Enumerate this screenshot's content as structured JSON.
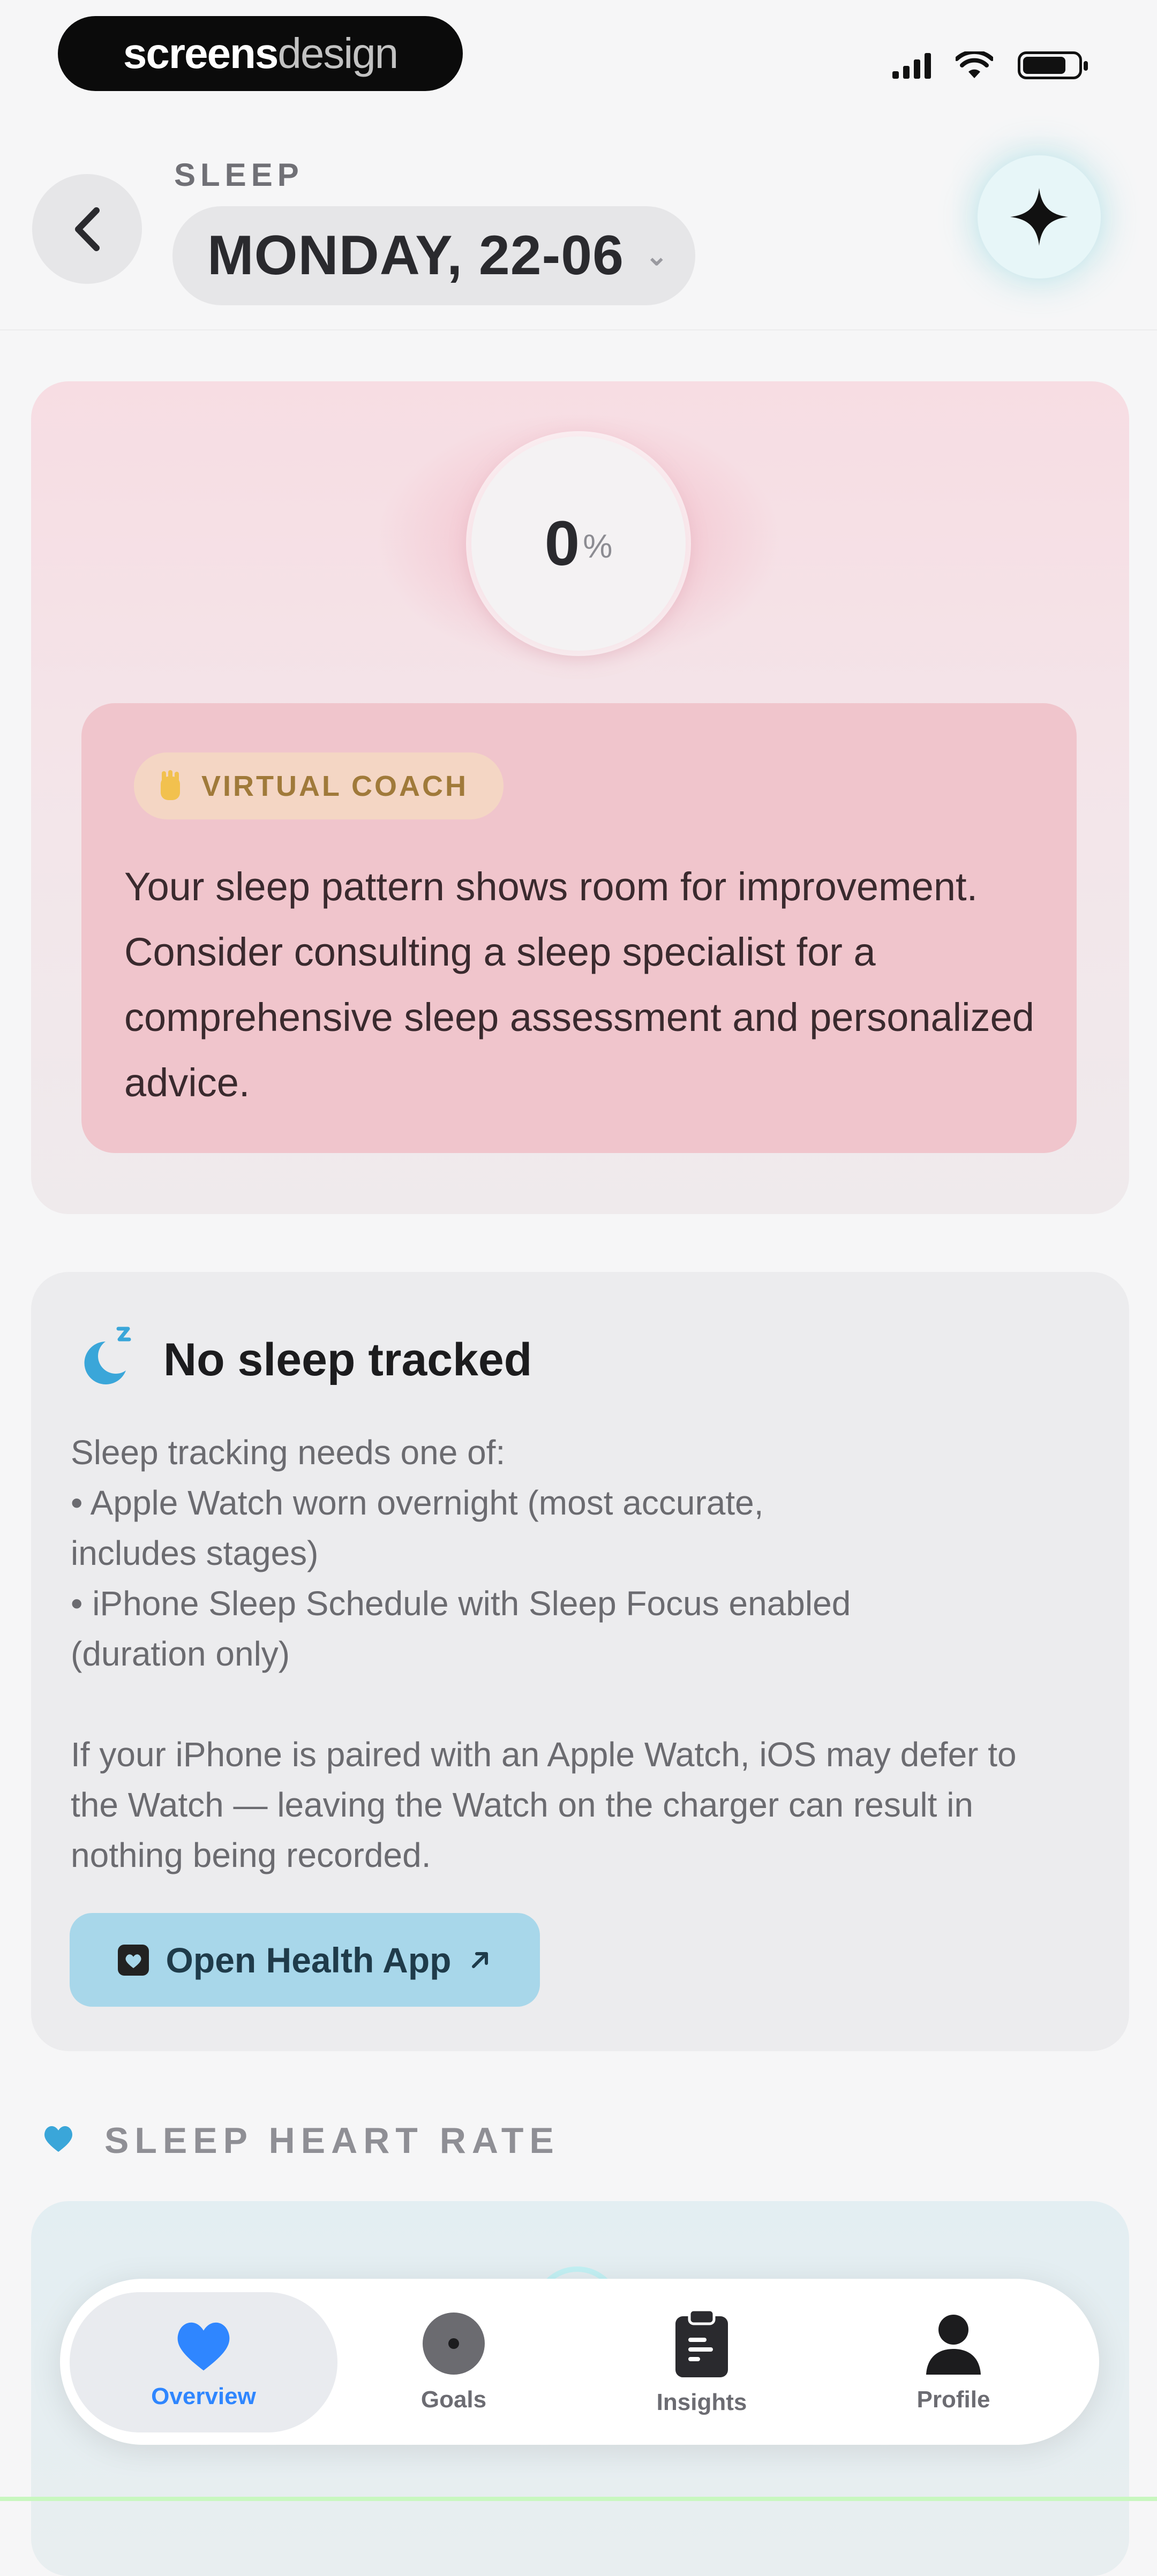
{
  "status_bar": {
    "brand_bold": "screens",
    "brand_light": "design"
  },
  "header": {
    "section": "SLEEP",
    "date": "MONDAY, 22-06"
  },
  "score": {
    "value": "0",
    "unit": "%"
  },
  "coach": {
    "badge": "VIRTUAL COACH",
    "message": "Your sleep pattern shows room for improvement. Consider consulting a sleep specialist for a comprehensive sleep assessment and personalized advice."
  },
  "no_sleep": {
    "title": "No sleep tracked",
    "body": "Sleep tracking needs one of:\n• Apple Watch worn overnight (most accurate,\nincludes stages)\n• iPhone Sleep Schedule with Sleep Focus enabled\n(duration only)\n\nIf your iPhone is paired with an Apple Watch, iOS may defer to\nthe Watch — leaving the Watch on the charger can result in\nnothing being recorded.",
    "button": "Open Health App"
  },
  "heart_rate": {
    "label": "SLEEP HEART RATE"
  },
  "tabs": [
    {
      "label": "Overview",
      "icon": "heart-icon"
    },
    {
      "label": "Goals",
      "icon": "target-icon"
    },
    {
      "label": "Insights",
      "icon": "clipboard-icon"
    },
    {
      "label": "Profile",
      "icon": "person-icon"
    }
  ],
  "colors": {
    "accent": "#2f86ff",
    "coach_bg": "#f0c5cc",
    "health_button": "#a8d7ea"
  }
}
